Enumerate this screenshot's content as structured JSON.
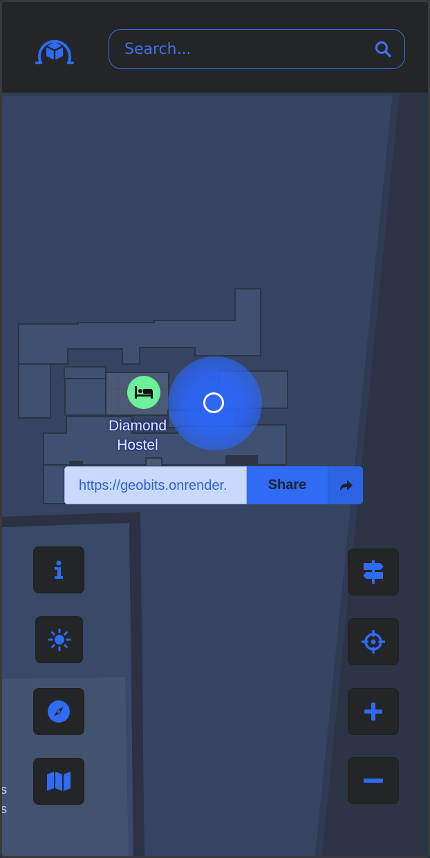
{
  "search": {
    "placeholder": "Search..."
  },
  "poi": {
    "name_line1": "Diamond",
    "name_line2": "Hostel",
    "icon": "bed-icon"
  },
  "share": {
    "url": "https://geobits.onrender.",
    "button_label": "Share"
  },
  "left_controls": [
    "info-icon",
    "brightness-icon",
    "compass-icon",
    "map-icon"
  ],
  "right_controls": [
    "signpost-icon",
    "locate-icon",
    "zoom-in-icon",
    "zoom-out-icon"
  ],
  "colors": {
    "accent": "#2f6bf3",
    "poi": "#6cf09a",
    "header_bg": "#242527",
    "map_bg": "#2a2f3a"
  }
}
